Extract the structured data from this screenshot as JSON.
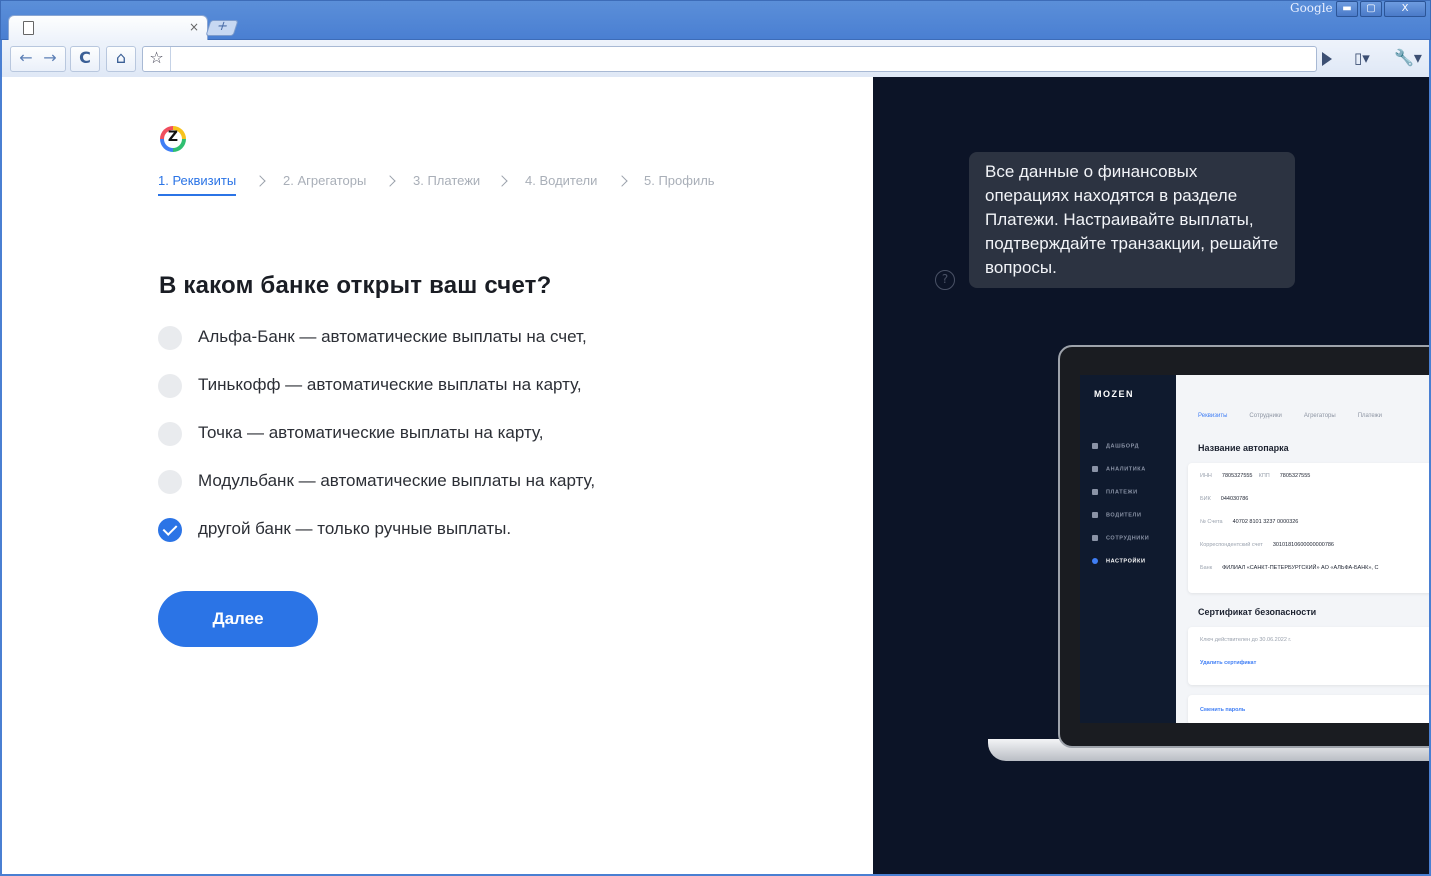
{
  "browser": {
    "brand": "Google",
    "tab_close": "×",
    "new_tab": "+",
    "window_buttons": {
      "minimize": "▬",
      "maximize": "▢",
      "close": "X"
    },
    "nav": {
      "back": "←",
      "forward": "→",
      "reload": "C",
      "home": "⌂",
      "star": "☆",
      "page_menu": "▯▾",
      "tools_menu": "🔧▾"
    }
  },
  "steps": [
    {
      "label": "1. Реквизиты",
      "active": true
    },
    {
      "label": "2. Агрегаторы",
      "active": false
    },
    {
      "label": "3. Платежи",
      "active": false
    },
    {
      "label": "4. Водители",
      "active": false
    },
    {
      "label": "5. Профиль",
      "active": false
    }
  ],
  "question": "В каком банке открыт ваш счет?",
  "options": [
    {
      "label": "Альфа-Банк — автоматические выплаты на счет,",
      "checked": false
    },
    {
      "label": "Тинькофф — автоматические выплаты на карту,",
      "checked": false
    },
    {
      "label": "Точка — автоматические выплаты на карту,",
      "checked": false
    },
    {
      "label": "Модульбанк — автоматические выплаты на карту,",
      "checked": false
    },
    {
      "label": "другой банк — только ручные выплаты.",
      "checked": true
    }
  ],
  "next_button": "Далее",
  "help_icon": "?",
  "tooltip": "Все данные о финансовых операциях находятся в разделе Платежи. Настраивайте выплаты, подтверждайте транзакции, решайте вопросы.",
  "app_preview": {
    "brand": "MOZEN",
    "nav": [
      "ДАШБОРД",
      "АНАЛИТИКА",
      "ПЛАТЕЖИ",
      "ВОДИТЕЛИ",
      "СОТРУДНИКИ",
      "НАСТРОЙКИ"
    ],
    "tabs": [
      "Реквизиты",
      "Сотрудники",
      "Агрегаторы",
      "Платежи"
    ],
    "company_heading": "Название автопарка",
    "fields": {
      "inn_label": "ИНН",
      "inn": "7805327555",
      "kpp_label": "КПП",
      "kpp": "7805327555",
      "bik_label": "БИК",
      "bik": "044030786",
      "account_label": "№ Счета",
      "account": "40702 8101 3237 0000326",
      "corr_label": "Корреспондентский счет",
      "corr": "30101810600000000786",
      "bank_label": "Банк",
      "bank": "ФИЛИАЛ «САНКТ-ПЕТЕРБУРГСКИЙ» АО «АЛЬФА-БАНК», С"
    },
    "cert_heading": "Сертификат безопасности",
    "cert_valid": "Ключ действителен до 30.06.2022 г.",
    "delete_cert": "Удалить сертификат",
    "change_password": "Сменить пароль"
  },
  "colors": {
    "accent": "#2b74e6",
    "dark_panel": "#0c1427",
    "tooltip_bg": "#2c3341"
  }
}
